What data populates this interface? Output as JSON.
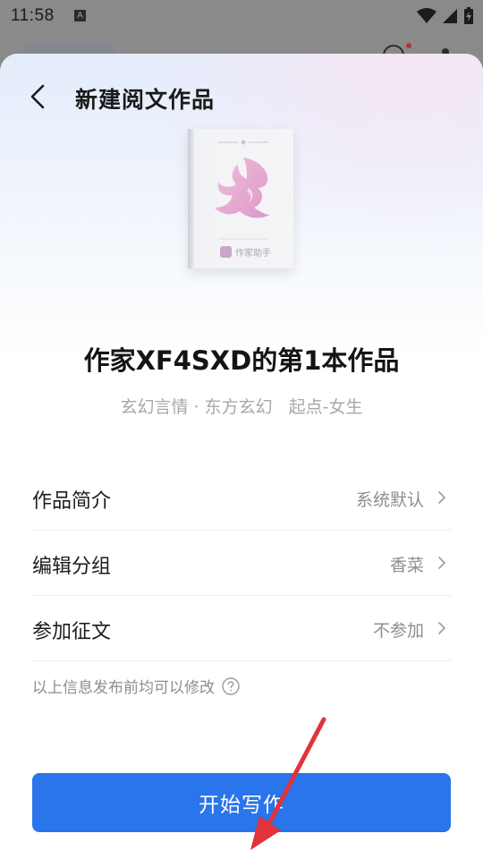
{
  "status_bar": {
    "time": "11:58",
    "a_badge": "A",
    "icons": [
      "wifi-icon",
      "signal-icon",
      "battery-charging-icon"
    ]
  },
  "header": {
    "title": "新建阅文作品",
    "back_icon": "back-chevron-icon"
  },
  "book_cover": {
    "brand": "作家助手"
  },
  "work": {
    "title": "作家XF4SXD的第1本作品",
    "genre": "玄幻言情 · 东方玄幻",
    "channel": "起点-女生"
  },
  "settings": [
    {
      "label": "作品简介",
      "value": "系统默认"
    },
    {
      "label": "编辑分组",
      "value": "香菜"
    },
    {
      "label": "参加征文",
      "value": "不参加"
    }
  ],
  "hint": {
    "text": "以上信息发布前均可以修改",
    "icon": "help-circle-icon"
  },
  "primary_button": {
    "label": "开始写作"
  },
  "colors": {
    "accent": "#2a74ec",
    "annotation_arrow": "#e0333a"
  }
}
